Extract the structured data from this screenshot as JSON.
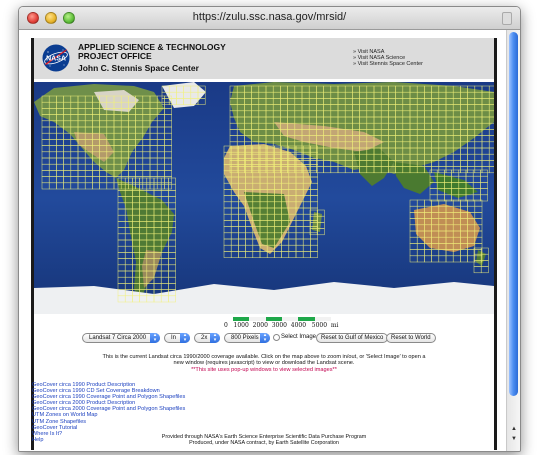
{
  "window": {
    "url": "https://zulu.ssc.nasa.gov/mrsid/"
  },
  "header": {
    "logo_text": "NASA",
    "title_lines": [
      "APPLIED SCIENCE & TECHNOLOGY",
      "PROJECT OFFICE"
    ],
    "subtitle": "John C. Stennis Space Center",
    "links": [
      "» Visit NASA",
      "» Visit NASA Science",
      "» Visit Stennis Space Center"
    ]
  },
  "scale": {
    "labels": "0   1000  2000  3000  4000   5000  mi",
    "colors": [
      "#1fa84a",
      "#f2f2f2",
      "#1fa84a",
      "#f2f2f2",
      "#1fa84a",
      "#f2f2f2"
    ]
  },
  "controls": {
    "dataset": "Landsat 7 Circa 2000",
    "zoom_dir": "In",
    "zoom_factor": "2x",
    "size": "800 Pixels",
    "select_image_label": "Select Image",
    "reset_gulf": "Reset to Gulf of Mexico",
    "reset_world": "Reset to World"
  },
  "description": {
    "line1": "This is the current Landsat circa 1990/2000 coverage available. Click on the map above to zoom in/out, or 'Select Image' to open a",
    "line2": "new window (requires javascript) to view or download the Landsat scene.",
    "warning": "**This site uses pop-up windows to view selected images**"
  },
  "links": [
    "GeoCover circa 1990 Product Description",
    "GeoCover circa 1990 CD Set Coverage Breakdown",
    "GeoCover circa 1990 Coverage Point and Polygon Shapefiles",
    "GeoCover circa 2000 Product Description",
    "GeoCover circa 2000 Coverage Point and Polygon Shapefiles",
    "UTM Zones on World Map",
    "UTM Zone Shapefiles",
    "GeoCover Tutorial",
    "Where Is It?",
    "Help"
  ],
  "footer": {
    "line1": "Provided through NASA's Earth Science Enterprise Scientific Data Purchase Program",
    "line2": "Produced, under NASA contract, by Earth Satellite Corporation"
  },
  "colors": {
    "ocean": "#1e3f8f",
    "grid": "#f2f27a",
    "link": "#1a3fbf",
    "warning": "#c0004e"
  }
}
